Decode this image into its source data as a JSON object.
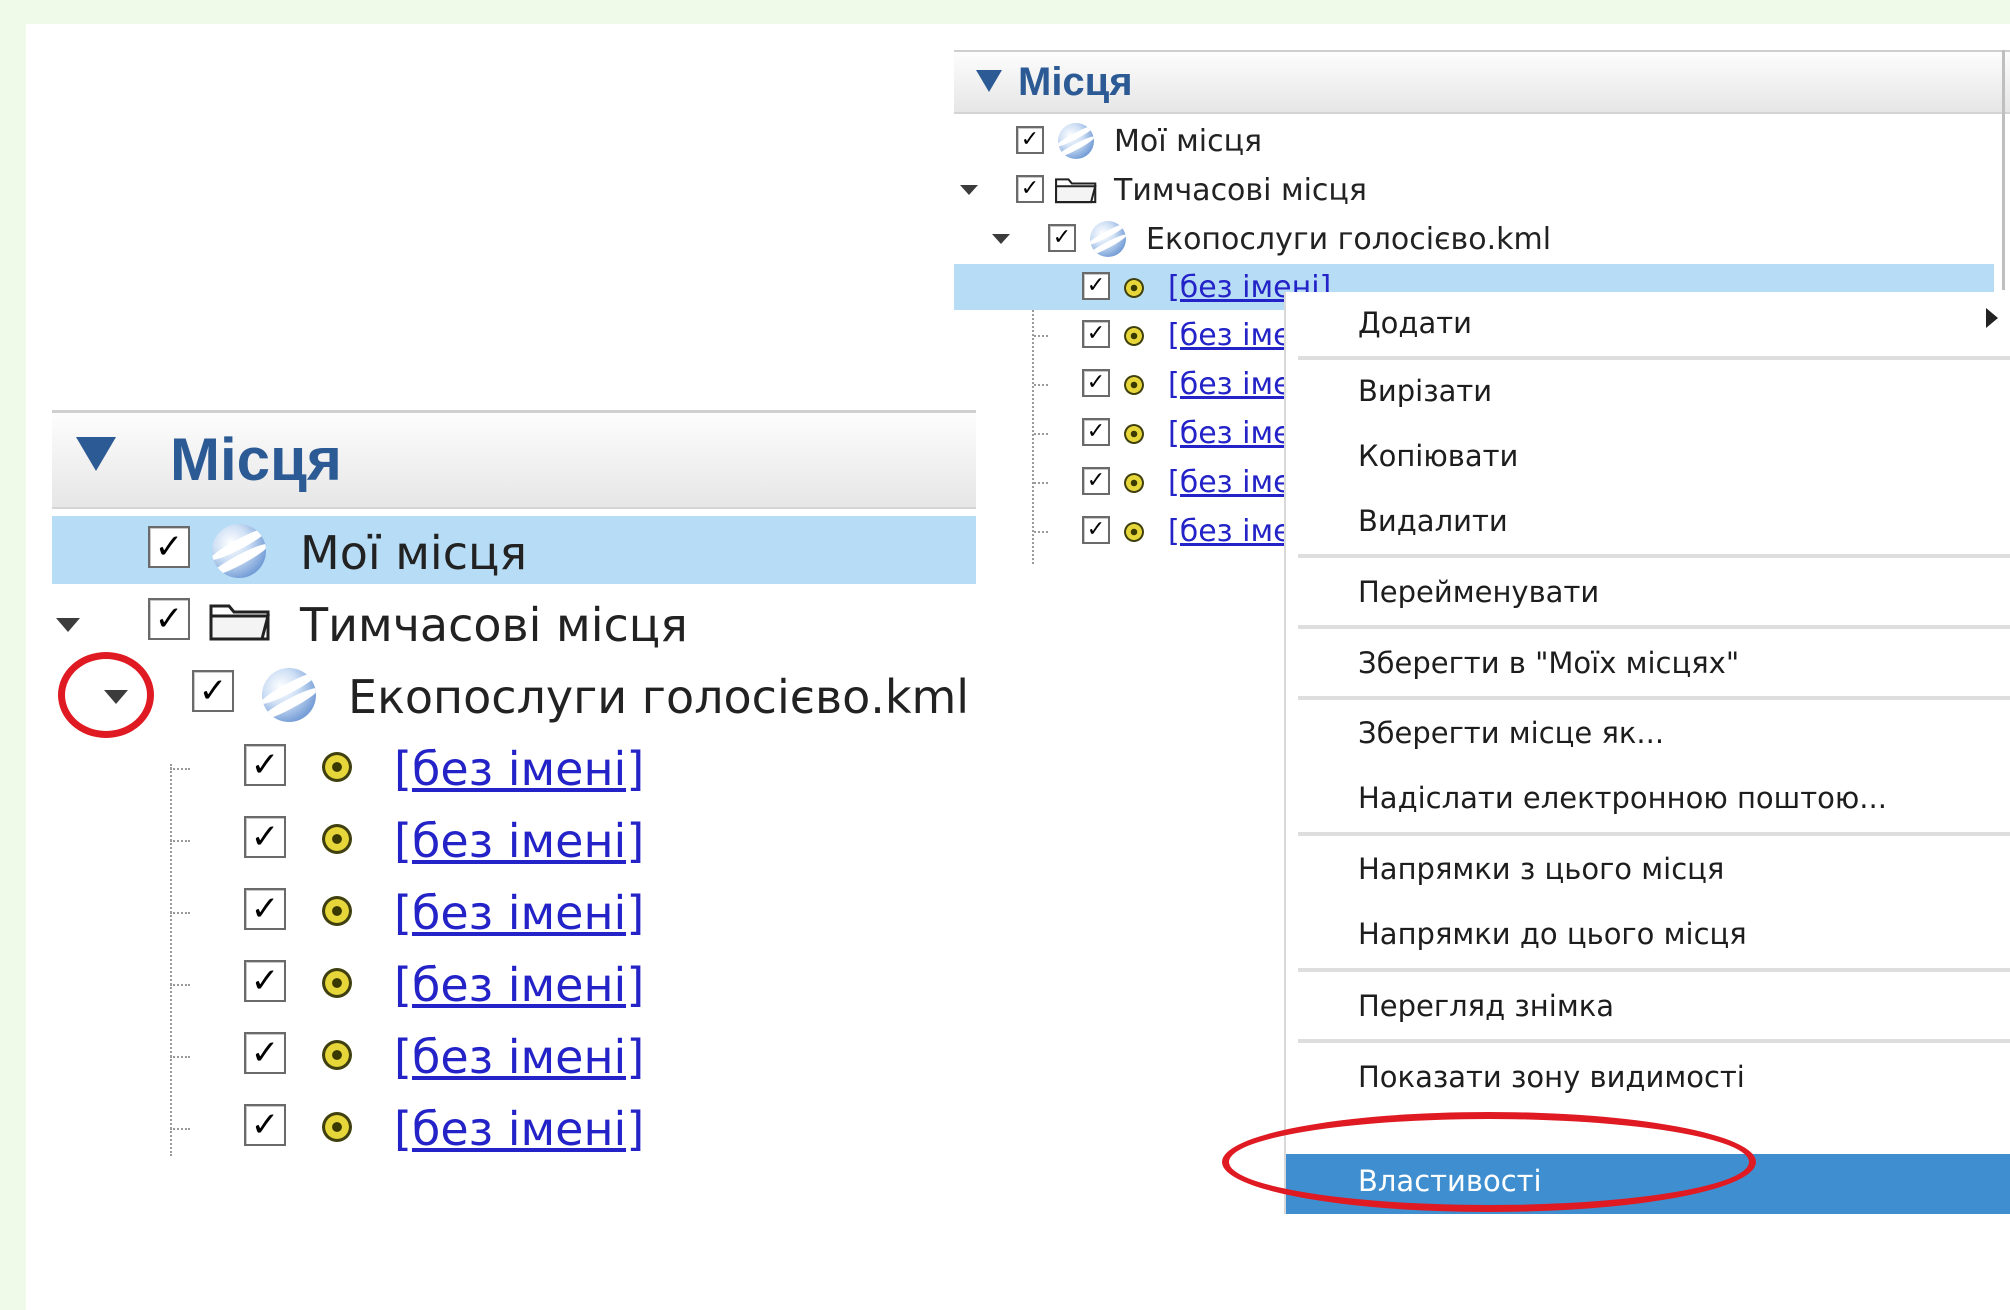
{
  "left_panel": {
    "header": {
      "title": "Місця"
    },
    "tree": {
      "my_places": "Мої місця",
      "temp_places": "Тимчасові місця",
      "kml_file": "Екопослуги голосієво.kml",
      "placemarks": [
        "[без імені]",
        "[без імені]",
        "[без імені]",
        "[без імені]",
        "[без імені]",
        "[без імені]"
      ]
    }
  },
  "right_panel": {
    "header": {
      "title": "Місця"
    },
    "tree": {
      "my_places": "Мої місця",
      "temp_places": "Тимчасові місця",
      "kml_file": "Екопослуги голосієво.kml",
      "placemarks": [
        "[без імені]",
        "[без іме",
        "[без іме",
        "[без іме",
        "[без іме",
        "[без іме"
      ]
    }
  },
  "context_menu": {
    "items": [
      "Додати",
      "Вирізати",
      "Копіювати",
      "Видалити",
      "Перейменувати",
      "Зберегти в \"Моїх місцях\"",
      "Зберегти місце як...",
      "Надіслати електронною поштою...",
      "Напрямки з цього місця",
      "Напрямки до цього місця",
      "Перегляд знімка",
      "Показати зону видимості",
      "Властивості"
    ],
    "highlighted_item": "Властивості"
  },
  "checkbox_mark": "✓",
  "colors": {
    "accent": "#2c5a94",
    "selection": "#b7dcf6",
    "menu_highlight": "#3f8fd0",
    "annotation": "#e01a22",
    "link": "#2323c8"
  }
}
